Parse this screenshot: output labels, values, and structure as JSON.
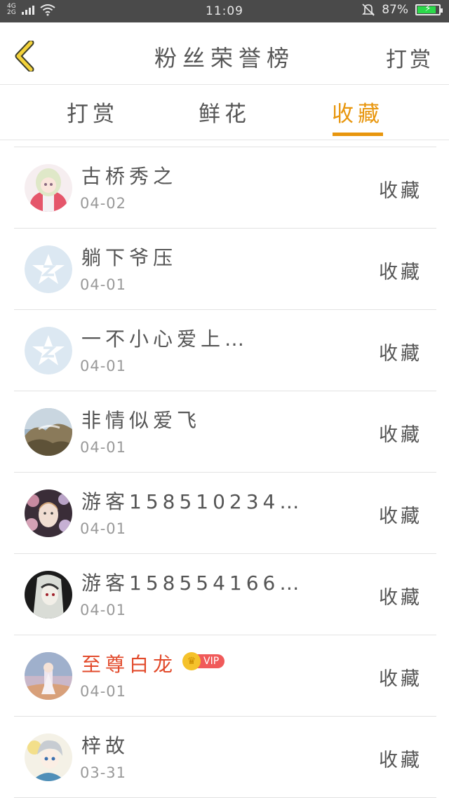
{
  "status_bar": {
    "network": "4G\n2G",
    "time": "11:09",
    "battery_percent": "87%",
    "battery_level": 0.87
  },
  "header": {
    "title": "粉丝荣誉榜",
    "action": "打赏"
  },
  "tabs": [
    {
      "label": "打赏",
      "active": false
    },
    {
      "label": "鲜花",
      "active": false
    },
    {
      "label": "收藏",
      "active": true
    }
  ],
  "colors": {
    "accent": "#e8960d",
    "vip_name": "#e24a2b",
    "vip_tag": "#f05a5a"
  },
  "fans": [
    {
      "name": "古桥秀之",
      "date": "04-02",
      "action": "收藏",
      "avatar": "anime-girl-avatar",
      "vip": false
    },
    {
      "name": "躺下爷压",
      "date": "04-01",
      "action": "收藏",
      "avatar": "default-avatar",
      "vip": false
    },
    {
      "name": "一不小心爱上…",
      "date": "04-01",
      "action": "收藏",
      "avatar": "default-avatar",
      "vip": false
    },
    {
      "name": "非情似爱飞",
      "date": "04-01",
      "action": "收藏",
      "avatar": "landscape-avatar",
      "vip": false
    },
    {
      "name": "游客158510234…",
      "date": "04-01",
      "action": "收藏",
      "avatar": "flower-portrait-avatar",
      "vip": false
    },
    {
      "name": "游客158554166…",
      "date": "04-01",
      "action": "收藏",
      "avatar": "dark-illustration-avatar",
      "vip": false
    },
    {
      "name": "至尊白龙",
      "date": "04-01",
      "action": "收藏",
      "avatar": "sky-character-avatar",
      "vip": true,
      "vip_label": "VIP"
    },
    {
      "name": "梓故",
      "date": "03-31",
      "action": "收藏",
      "avatar": "chibi-avatar",
      "vip": false
    }
  ]
}
